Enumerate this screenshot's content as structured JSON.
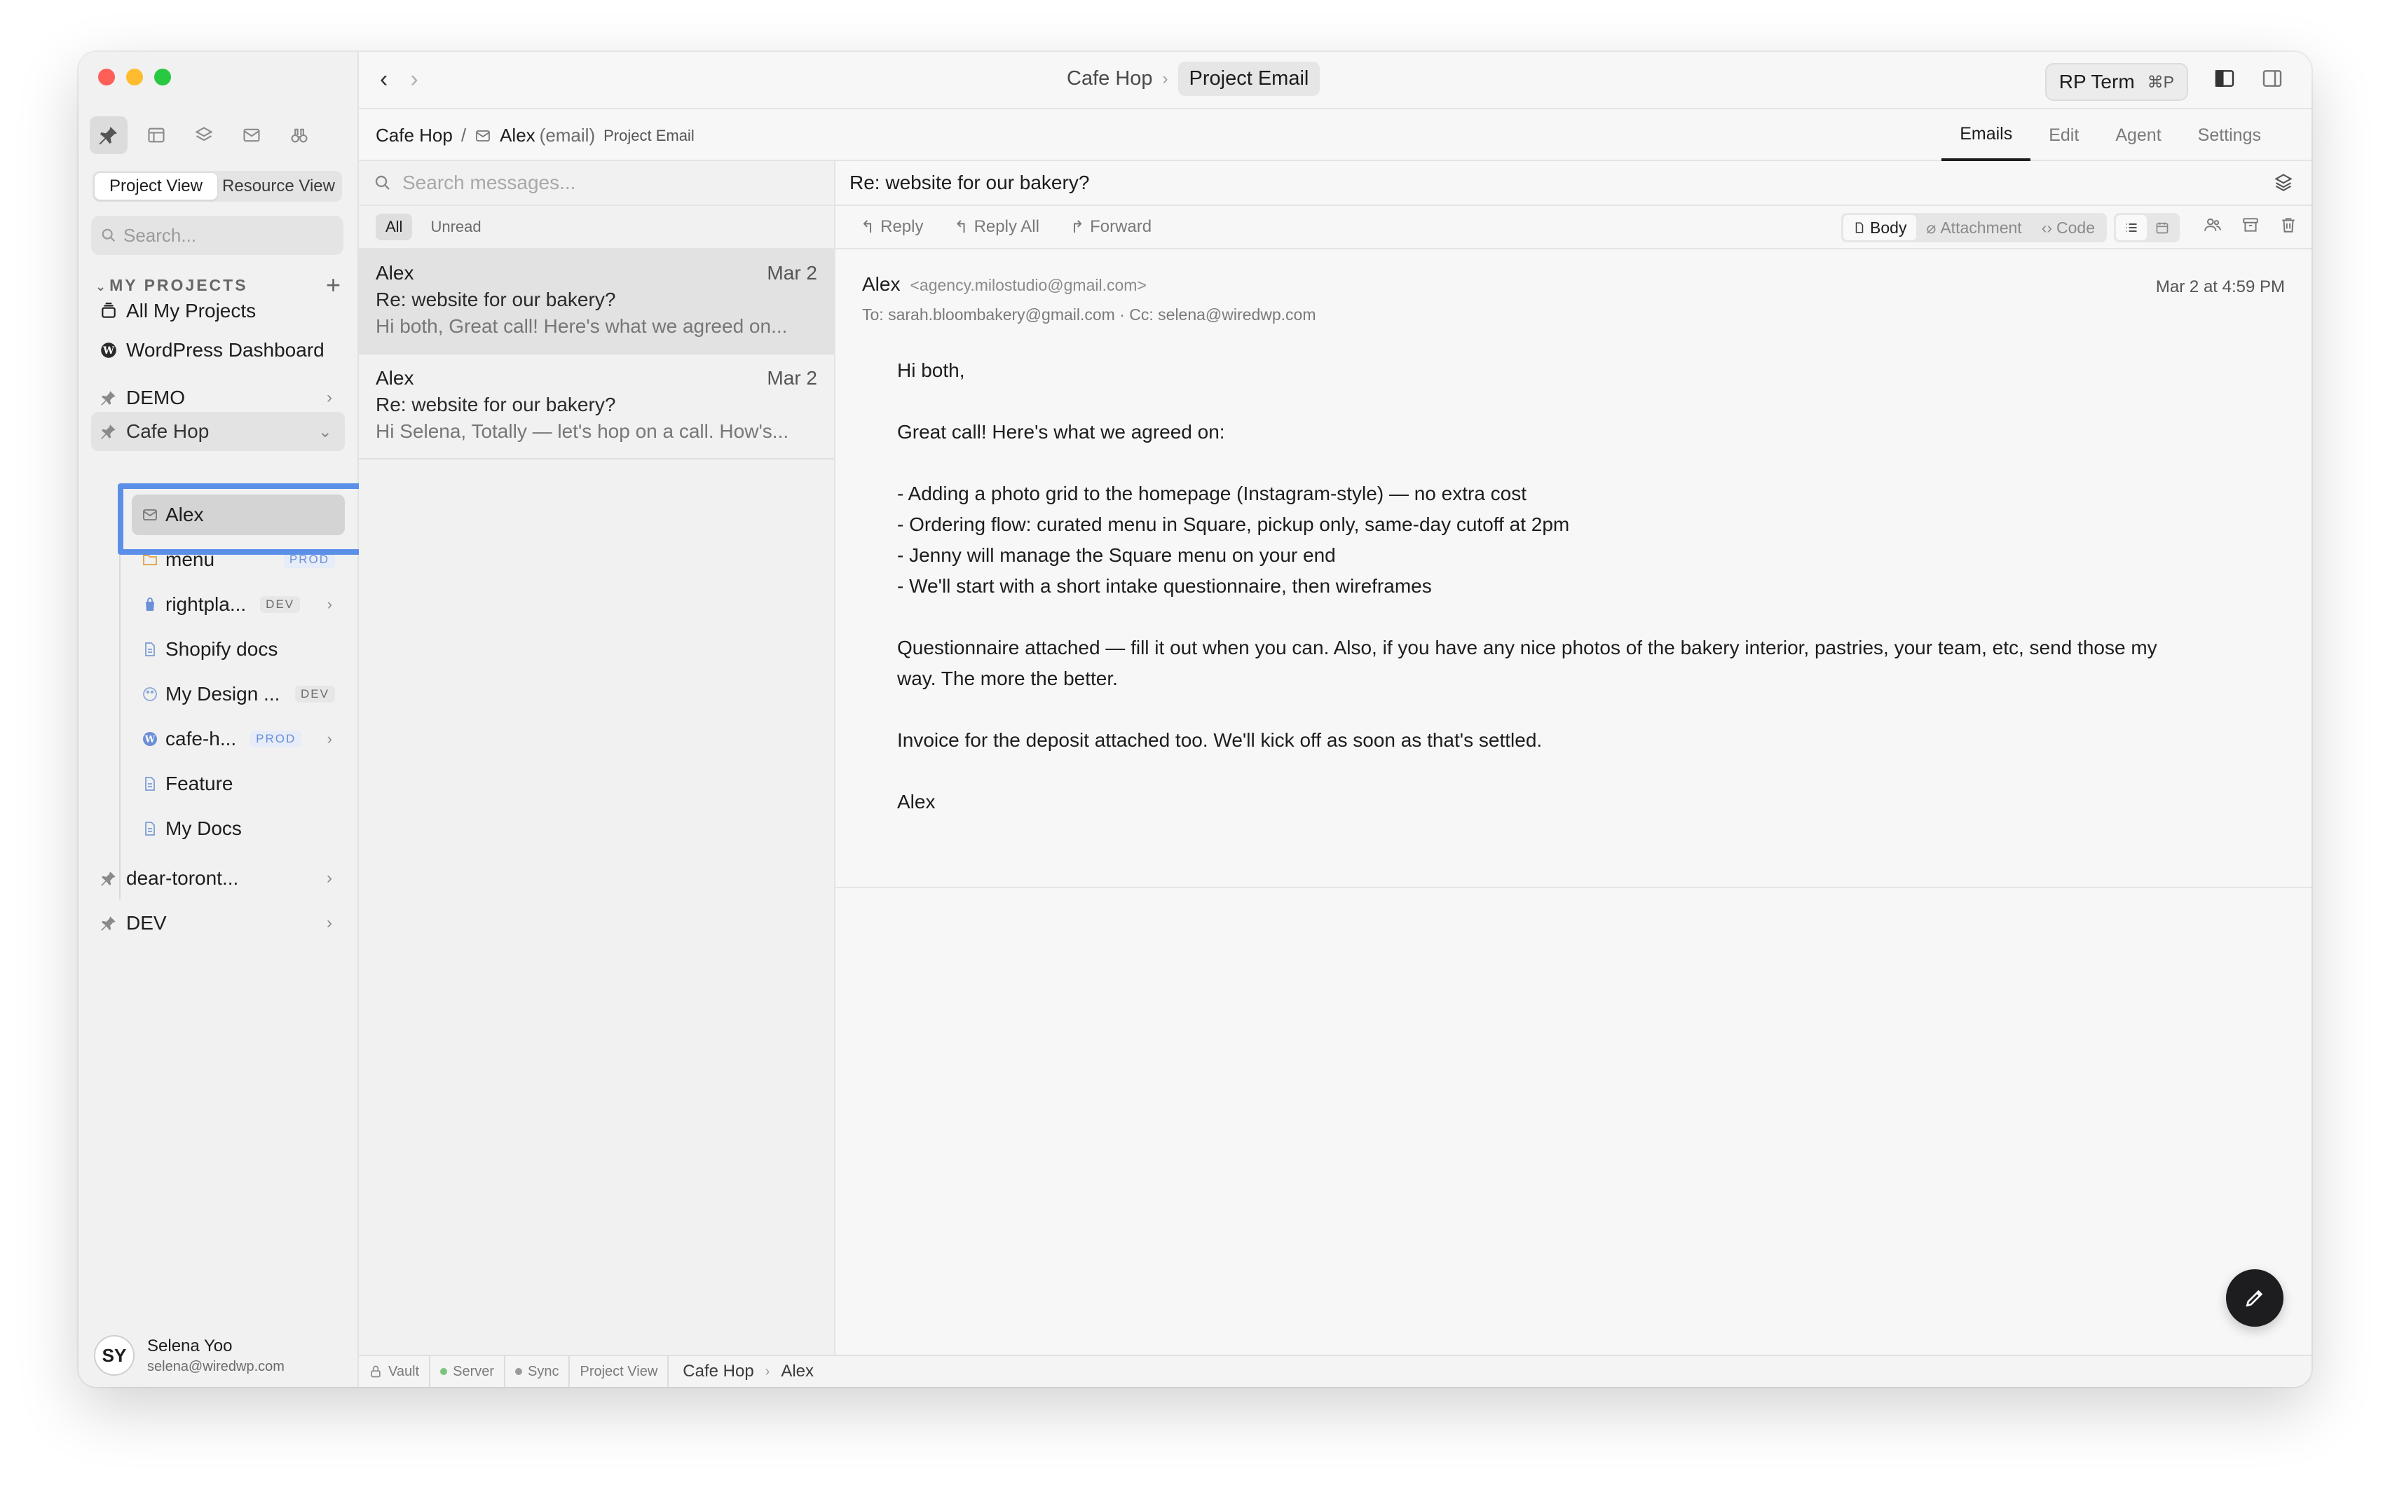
{
  "window": {
    "traffic_lights": [
      "#fe5f57",
      "#febc2e",
      "#28c840"
    ]
  },
  "sidebar": {
    "view_tabs": [
      {
        "label": "Project View",
        "active": true
      },
      {
        "label": "Resource View",
        "active": false
      }
    ],
    "search_placeholder": "Search...",
    "section_title": "MY PROJECTS",
    "top_items": [
      {
        "label": "All My Projects",
        "icon": "stack-icon"
      },
      {
        "label": "WordPress Dashboard",
        "icon": "wordpress-icon"
      },
      {
        "label": "DEMO",
        "icon": "pin-icon"
      },
      {
        "label": "Cafe Hop",
        "icon": "pin-icon"
      }
    ],
    "children": [
      {
        "label": "Alex",
        "icon": "mail-icon"
      },
      {
        "label": "menu",
        "icon": "folder-icon",
        "badge": "PROD"
      },
      {
        "label": "rightpla...",
        "icon": "shopify-icon",
        "badge": "DEV"
      },
      {
        "label": "Shopify docs",
        "icon": "document-icon"
      },
      {
        "label": "My Design ...",
        "icon": "palette-icon",
        "badge": "DEV"
      },
      {
        "label": "cafe-h...",
        "icon": "wordpress-icon",
        "badge": "PROD"
      },
      {
        "label": "Feature",
        "icon": "document-icon"
      },
      {
        "label": "My Docs",
        "icon": "document-icon"
      }
    ],
    "bottom_items": [
      {
        "label": "dear-toront...",
        "icon": "pin-icon"
      },
      {
        "label": "DEV",
        "icon": "pin-icon"
      }
    ],
    "user": {
      "initials": "SY",
      "name": "Selena Yoo",
      "email": "selena@wiredwp.com"
    }
  },
  "topbar": {
    "breadcrumb_parent": "Cafe Hop",
    "breadcrumb_current": "Project Email",
    "rp_term_label": "RP Term",
    "rp_term_shortcut": "⌘P"
  },
  "subbar": {
    "project": "Cafe Hop",
    "separator": "/",
    "contact": "Alex",
    "contact_type": "(email)",
    "context": "Project Email",
    "tabs": [
      {
        "label": "Emails",
        "active": true
      },
      {
        "label": "Edit",
        "active": false
      },
      {
        "label": "Agent",
        "active": false
      },
      {
        "label": "Settings",
        "active": false
      }
    ]
  },
  "list": {
    "search_placeholder": "Search messages...",
    "filters": [
      {
        "label": "All",
        "active": true
      },
      {
        "label": "Unread",
        "active": false
      }
    ],
    "messages": [
      {
        "sender": "Alex",
        "date": "Mar 2",
        "subject": "Re: website for our bakery?",
        "preview": "Hi both, Great call! Here's what we agreed on...",
        "selected": true
      },
      {
        "sender": "Alex",
        "date": "Mar 2",
        "subject": "Re: website for our bakery?",
        "preview": "Hi Selena, Totally — let's hop on a call. How's...",
        "selected": false
      }
    ]
  },
  "reader": {
    "subject": "Re: website for our bakery?",
    "actions": [
      "Reply",
      "Reply All",
      "Forward"
    ],
    "view_modes": [
      {
        "label": "Body",
        "active": true
      },
      {
        "label": "Attachment",
        "active": false
      },
      {
        "label": "Code",
        "active": false
      }
    ],
    "email": {
      "from_name": "Alex",
      "from_addr": "<agency.milostudio@gmail.com>",
      "recipients": "To: sarah.bloombakery@gmail.com · Cc: selena@wiredwp.com",
      "date": "Mar 2 at 4:59 PM",
      "greeting": "Hi both,",
      "intro": "Great call! Here's what we agreed on:",
      "bullets": [
        "- Adding a photo grid to the homepage (Instagram-style) — no extra cost",
        "- Ordering flow: curated menu in Square, pickup only, same-day cutoff at 2pm",
        "- Jenny will manage the Square menu on your end",
        "- We'll start with a short intake questionnaire, then wireframes"
      ],
      "para1": "Questionnaire attached — fill it out when you can. Also, if you have any nice photos of the bakery interior, pastries, your team, etc, send those my way. The more the better.",
      "para2": "Invoice for the deposit attached too. We'll kick off as soon as that's settled.",
      "signature": "Alex"
    }
  },
  "status": {
    "vault": "Vault",
    "server": "Server",
    "sync": "Sync",
    "view": "Project View",
    "crumb_project": "Cafe Hop",
    "crumb_item": "Alex",
    "server_color": "#7cc47c",
    "sync_color": "#9a9a9a"
  }
}
